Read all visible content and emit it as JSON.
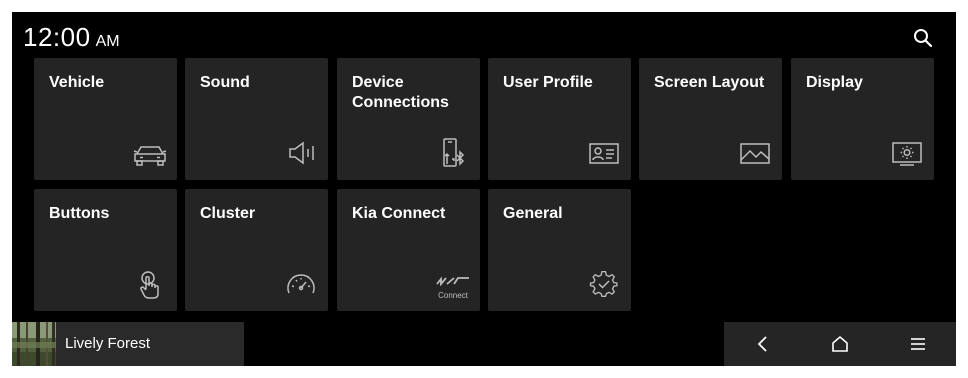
{
  "status_bar": {
    "time": "12:00",
    "ampm": "AM"
  },
  "tiles": [
    {
      "label": "Vehicle",
      "icon": "car-icon"
    },
    {
      "label": "Sound",
      "icon": "speaker-icon"
    },
    {
      "label": "Device Connections",
      "icon": "phone-bluetooth-icon"
    },
    {
      "label": "User Profile",
      "icon": "profile-card-icon"
    },
    {
      "label": "Screen Layout",
      "icon": "landscape-picture-icon"
    },
    {
      "label": "Display",
      "icon": "display-brightness-icon"
    },
    {
      "label": "Buttons",
      "icon": "finger-press-icon"
    },
    {
      "label": "Cluster",
      "icon": "gauge-icon"
    },
    {
      "label": "Kia Connect",
      "icon": "kia-connect-logo",
      "logo_text": "Connect"
    },
    {
      "label": "General",
      "icon": "gear-check-icon"
    }
  ],
  "media": {
    "title": "Lively Forest"
  },
  "nav": {
    "icons": [
      "back-icon",
      "home-icon",
      "menu-icon"
    ]
  },
  "colors": {
    "background": "#000000",
    "tile": "#242424",
    "text": "#ffffff",
    "icon": "#bdbdbd"
  }
}
